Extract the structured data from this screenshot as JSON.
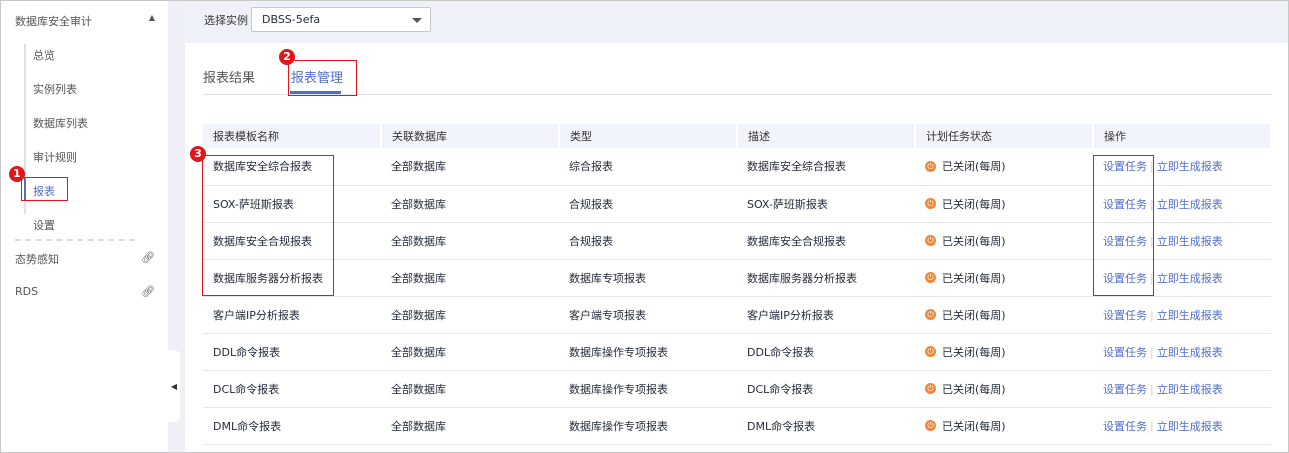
{
  "sidebar": {
    "title": "数据库安全审计",
    "items": [
      "总览",
      "实例列表",
      "数据库列表",
      "审计规则",
      "报表",
      "设置"
    ],
    "links": [
      "态势感知",
      "RDS"
    ]
  },
  "instance": {
    "label": "选择实例",
    "value": "DBSS-5efa"
  },
  "tabs": [
    "报表结果",
    "报表管理"
  ],
  "table": {
    "headers": [
      "报表模板名称",
      "关联数据库",
      "类型",
      "描述",
      "计划任务状态",
      "操作"
    ],
    "rows": [
      [
        "数据库安全综合报表",
        "全部数据库",
        "综合报表",
        "数据库安全综合报表",
        "已关闭(每周)"
      ],
      [
        "SOX-萨班斯报表",
        "全部数据库",
        "合规报表",
        "SOX-萨班斯报表",
        "已关闭(每周)"
      ],
      [
        "数据库安全合规报表",
        "全部数据库",
        "合规报表",
        "数据库安全合规报表",
        "已关闭(每周)"
      ],
      [
        "数据库服务器分析报表",
        "全部数据库",
        "数据库专项报表",
        "数据库服务器分析报表",
        "已关闭(每周)"
      ],
      [
        "客户端IP分析报表",
        "全部数据库",
        "客户端专项报表",
        "客户端IP分析报表",
        "已关闭(每周)"
      ],
      [
        "DDL命令报表",
        "全部数据库",
        "数据库操作专项报表",
        "DDL命令报表",
        "已关闭(每周)"
      ],
      [
        "DCL命令报表",
        "全部数据库",
        "数据库操作专项报表",
        "DCL命令报表",
        "已关闭(每周)"
      ],
      [
        "DML命令报表",
        "全部数据库",
        "数据库操作专项报表",
        "DML命令报表",
        "已关闭(每周)"
      ]
    ],
    "actions": {
      "set_task": "设置任务",
      "generate": "立即生成报表"
    }
  },
  "badges": [
    "1",
    "2",
    "3"
  ]
}
